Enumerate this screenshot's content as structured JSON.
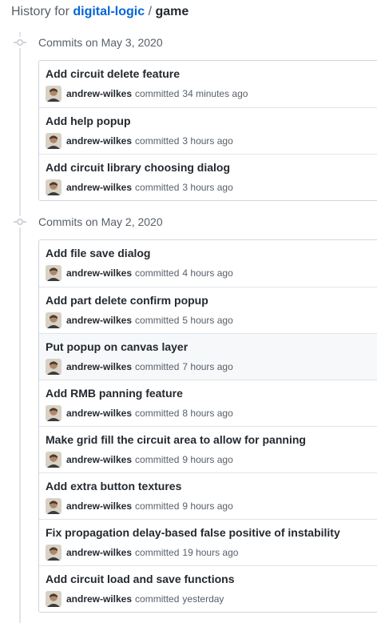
{
  "header": {
    "prefix": "History for",
    "repo": "digital-logic",
    "separator": "/",
    "file": "game"
  },
  "groups": [
    {
      "date_label": "Commits on May 3, 2020",
      "commits": [
        {
          "title": "Add circuit delete feature",
          "author": "andrew-wilkes",
          "verb": "committed",
          "time": "34 minutes ago"
        },
        {
          "title": "Add help popup",
          "author": "andrew-wilkes",
          "verb": "committed",
          "time": "3 hours ago"
        },
        {
          "title": "Add circuit library choosing dialog",
          "author": "andrew-wilkes",
          "verb": "committed",
          "time": "3 hours ago"
        }
      ]
    },
    {
      "date_label": "Commits on May 2, 2020",
      "commits": [
        {
          "title": "Add file save dialog",
          "author": "andrew-wilkes",
          "verb": "committed",
          "time": "4 hours ago"
        },
        {
          "title": "Add part delete confirm popup",
          "author": "andrew-wilkes",
          "verb": "committed",
          "time": "5 hours ago"
        },
        {
          "title": "Put popup on canvas layer",
          "author": "andrew-wilkes",
          "verb": "committed",
          "time": "7 hours ago"
        },
        {
          "title": "Add RMB panning feature",
          "author": "andrew-wilkes",
          "verb": "committed",
          "time": "8 hours ago"
        },
        {
          "title": "Make grid fill the circuit area to allow for panning",
          "author": "andrew-wilkes",
          "verb": "committed",
          "time": "9 hours ago"
        },
        {
          "title": "Add extra button textures",
          "author": "andrew-wilkes",
          "verb": "committed",
          "time": "9 hours ago"
        },
        {
          "title": "Fix propagation delay-based false positive of instability",
          "author": "andrew-wilkes",
          "verb": "committed",
          "time": "19 hours ago"
        },
        {
          "title": "Add circuit load and save functions",
          "author": "andrew-wilkes",
          "verb": "committed",
          "time": "yesterday"
        }
      ]
    }
  ],
  "colors": {
    "link": "#0366d6",
    "muted": "#586069",
    "text": "#24292e",
    "border": "#d1d5da",
    "highlight_row": "#f6f8fa"
  },
  "icons": {
    "timeline_node": "git-commit-icon",
    "avatar": "user-avatar"
  }
}
